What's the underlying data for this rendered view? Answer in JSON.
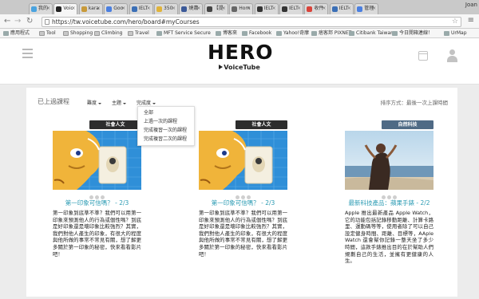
{
  "browser": {
    "tabs": [
      {
        "label": "我的",
        "color": "#4aa3df"
      },
      {
        "label": "Voic",
        "color": "#222222",
        "active": true
      },
      {
        "label": "kara",
        "color": "#c89a3a"
      },
      {
        "label": "Goo",
        "color": "#4a7fe0"
      },
      {
        "label": "IELT",
        "color": "#3b6fb6"
      },
      {
        "label": "350",
        "color": "#e0b33a"
      },
      {
        "label": "燒肅",
        "color": "#3b5998"
      },
      {
        "label": "【提",
        "color": "#444444"
      },
      {
        "label": "Hom",
        "color": "#666666"
      },
      {
        "label": "IELT",
        "color": "#333333"
      },
      {
        "label": "IELT",
        "color": "#333333"
      },
      {
        "label": "收件",
        "color": "#d9433a"
      },
      {
        "label": "IELT",
        "color": "#3b6fb6"
      },
      {
        "label": "管理",
        "color": "#4a7fe0"
      }
    ],
    "profile_name": "Joan",
    "url": "https://tw.voicetube.com/hero/board#myCourses",
    "bookmarks": [
      {
        "label": "應用程式",
        "type": "apps"
      },
      {
        "label": "Tool",
        "type": "folder"
      },
      {
        "label": "Shopping",
        "type": "folder"
      },
      {
        "label": "Climbing",
        "type": "folder"
      },
      {
        "label": "Travel",
        "type": "folder"
      },
      {
        "label": "MFT Service Secure",
        "type": "link"
      },
      {
        "label": "博客來",
        "type": "link"
      },
      {
        "label": "Facebook",
        "type": "link"
      },
      {
        "label": "Yahoo!奇摩",
        "type": "link"
      },
      {
        "label": "痞客邦 PIXNET",
        "type": "link"
      },
      {
        "label": "Citibank Taiwan",
        "type": "link"
      },
      {
        "label": "今日開箱連線！",
        "type": "link"
      },
      {
        "label": "UrMap",
        "type": "link"
      }
    ]
  },
  "site": {
    "logo_text": "HERO",
    "logo_sub": "VoiceTube"
  },
  "board": {
    "section_title": "已上過課程",
    "filters": [
      "難度",
      "主題",
      "完成度"
    ],
    "sort_label": "排序方式：最後一次上課時間",
    "dropdown": [
      "全部",
      "上過一次的課程",
      "完成複習一次的課程",
      "完成複習二次的課程"
    ],
    "cards": [
      {
        "badge": "社會人文",
        "badge_color": "#2d2d2d",
        "image": "cartoon-blue",
        "title": "第一印象可信嗎？ - 2/3",
        "description": "第一印象到底準不準？我們可以用第一印象來預測他人的行為或個性嗎？到底是好印象還是壞印象比較強烈？其實，我們對他人產生的印象，有很大的程度與他所做的事常不常見有關，想了解更多關於第一印象的秘密，快來看看影片吧！"
      },
      {
        "badge": "社會人文",
        "badge_color": "#2d2d2d",
        "image": "cartoon-blue",
        "title": "第一印象可信嗎？ - 2/3",
        "description": "第一印象到底準不準？我們可以用第一印象來預測他人的行為或個性嗎？到底是好印象還是壞印象比較強烈？其實，我們對他人產生的印象，有很大的程度與他所做的事常不常見有關，想了解更多關於第一印象的秘密，快來看看影片吧！"
      },
      {
        "badge": "自然科技",
        "badge_color": "#4f6a85",
        "image": "beach-runner",
        "title": "最新科技產品：蘋果手錶 - 2/2",
        "description": "Apple 推出最新產品 Apple Watch，它的功能包括記錄移動距離、計算卡路里、運動碼等等，使用者除了可以自己設定健身時間、距離、目標等，AAple Watch 還會幫你記錄一整天坐了多少時間，這款手錶推出目的在於幫助人們規劃自己的生活，並擁有更健康的人生。"
      }
    ]
  }
}
